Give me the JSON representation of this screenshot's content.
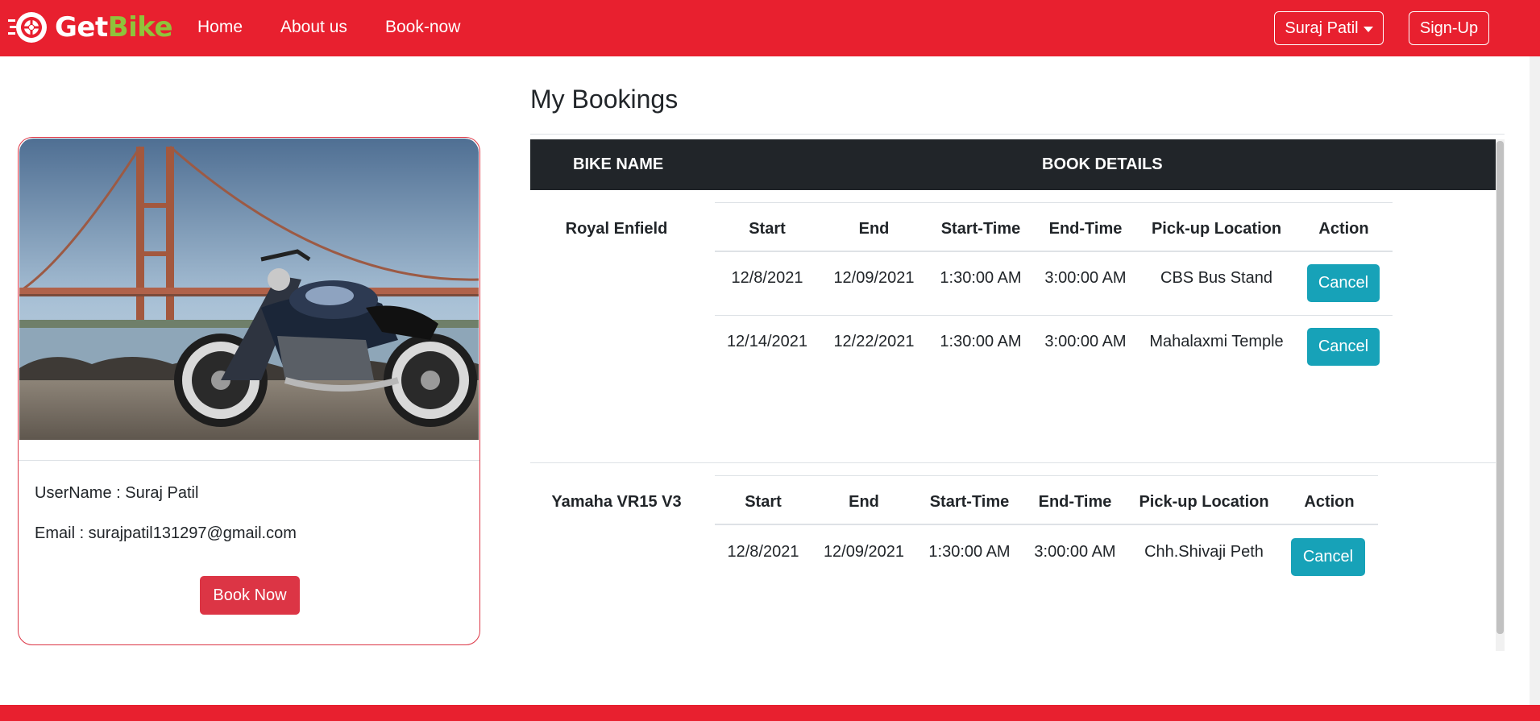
{
  "brand": {
    "part1": "Get",
    "part2": "Bike",
    "color_primary": "#e8202f",
    "color_accent": "#8fc33b",
    "icon": "wheel-logo-icon"
  },
  "nav": {
    "links": [
      "Home",
      "About us",
      "Book-now"
    ],
    "user_menu_label": "Suraj Patil",
    "signup_label": "Sign-Up"
  },
  "profile": {
    "image": "motorcycle-photo",
    "username_line": "UserName : Suraj Patil",
    "email_line": "Email : surajpatil131297@gmail.com",
    "book_button": "Book Now"
  },
  "bookings": {
    "title": "My Bookings",
    "headers": {
      "bike_name": "BIKE NAME",
      "book_details": "BOOK DETAILS"
    },
    "detail_columns": [
      "Start",
      "End",
      "Start-Time",
      "End-Time",
      "Pick-up Location",
      "Action"
    ],
    "groups": [
      {
        "bike": "Royal Enfield",
        "rows": [
          {
            "start": "12/8/2021",
            "end": "12/09/2021",
            "start_time": "1:30:00 AM",
            "end_time": "3:00:00 AM",
            "location": "CBS Bus Stand",
            "action": "Cancel"
          },
          {
            "start": "12/14/2021",
            "end": "12/22/2021",
            "start_time": "1:30:00 AM",
            "end_time": "3:00:00 AM",
            "location": "Mahalaxmi Temple",
            "action": "Cancel"
          }
        ]
      },
      {
        "bike": "Yamaha VR15 V3",
        "rows": [
          {
            "start": "12/8/2021",
            "end": "12/09/2021",
            "start_time": "1:30:00 AM",
            "end_time": "3:00:00 AM",
            "location": "Chh.Shivaji Peth",
            "action": "Cancel"
          }
        ]
      }
    ],
    "cancel_color": "#17a2b8"
  }
}
